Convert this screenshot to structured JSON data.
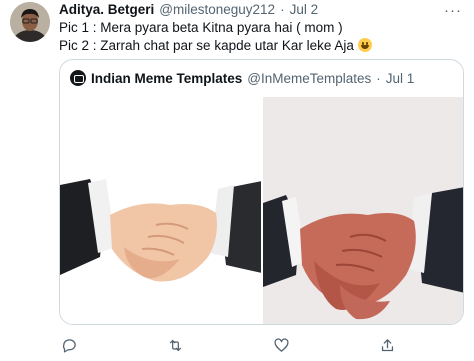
{
  "tweet": {
    "author_name": "Aditya. Betgeri",
    "author_handle": "@milestoneguy212",
    "separator": "·",
    "date": "Jul 2",
    "more_label": "···",
    "lines": [
      "Pic 1 : Mera pyara beta Kitna pyara hai ( mom )",
      "Pic 2 : Zarrah chat par se kapde utar Kar leke Aja"
    ],
    "line2_emoji": "grinning-face"
  },
  "quote": {
    "author_name": "Indian Meme Templates",
    "author_handle": "@InMemeTemplates",
    "separator": "·",
    "date": "Jul 1",
    "images": [
      {
        "description_icon": "handshake-clean-image"
      },
      {
        "description_icon": "handshake-red-dirty-image"
      }
    ]
  },
  "actions": [
    {
      "icon": "reply-icon"
    },
    {
      "icon": "retweet-icon"
    },
    {
      "icon": "like-icon"
    },
    {
      "icon": "share-icon"
    }
  ],
  "colors": {
    "text_primary": "#0f1419",
    "text_secondary": "#536471",
    "border": "#cfd9de",
    "icon": "#536471"
  }
}
